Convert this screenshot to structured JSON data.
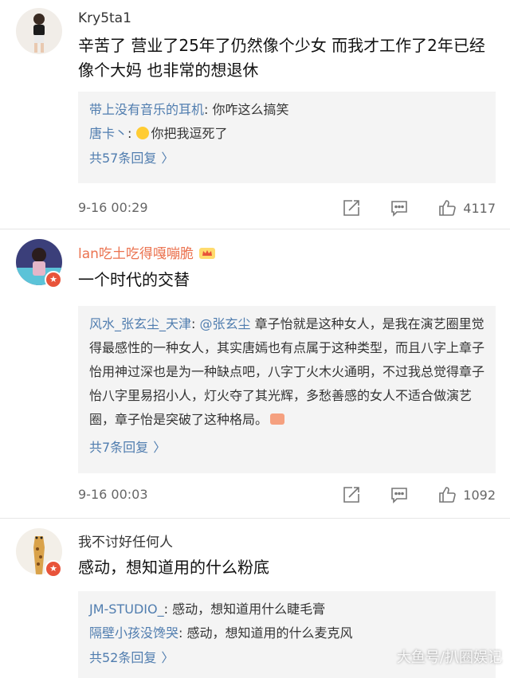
{
  "comments": [
    {
      "username": "Kry5ta1",
      "text": "辛苦了 营业了25年了仍然像个少女 而我才工作了2年已经像个大妈 也非常的想退休",
      "replies": [
        {
          "name": "带上没有音乐的耳机",
          "sep": ": ",
          "text": "你咋这么搞笑"
        },
        {
          "name": "唐卡丶",
          "sep": ": ",
          "text": "你把我逗死了"
        }
      ],
      "more": "共57条回复",
      "time": "9-16 00:29",
      "likes": "4117"
    },
    {
      "username": "lan吃土吃得嘎嘣脆",
      "text": "一个时代的交替",
      "replies": [
        {
          "name": "风水_张玄尘_天津",
          "sep": ": ",
          "mention": "@张玄尘",
          "text": " 章子怡就是这种女人，是我在演艺圈里觉得最感性的一种女人，其实唐嫣也有点属于这种类型，而且八字上章子怡用神过深也是为一种缺点吧，八字丁火木火通明，不过我总觉得章子怡八字里易招小人，灯火夺了其光辉，多愁善感的女人不适合做演艺圈，章子怡是突破了这种格局。"
        }
      ],
      "more": "共7条回复",
      "time": "9-16 00:03",
      "likes": "1092"
    },
    {
      "username": "我不讨好任何人",
      "text": "感动，想知道用的什么粉底",
      "replies": [
        {
          "name": "JM-STUDIO_",
          "sep": ": ",
          "text": "感动，想知道用什么睫毛膏"
        },
        {
          "name": "隔壁小孩没馋哭",
          "sep": ": ",
          "text": "感动，想知道用的什么麦克风"
        }
      ],
      "more": "共52条回复"
    }
  ],
  "more_chevron": "〉",
  "watermark": "大鱼号/扒圈娱记",
  "colors": {
    "link": "#507daf",
    "orange_name": "#eb7350",
    "badge": "#e8533a",
    "reply_bg": "#f4f4f4"
  },
  "icons": [
    "share-icon",
    "comment-icon",
    "like-icon",
    "verified-badge-icon",
    "crown-icon"
  ]
}
